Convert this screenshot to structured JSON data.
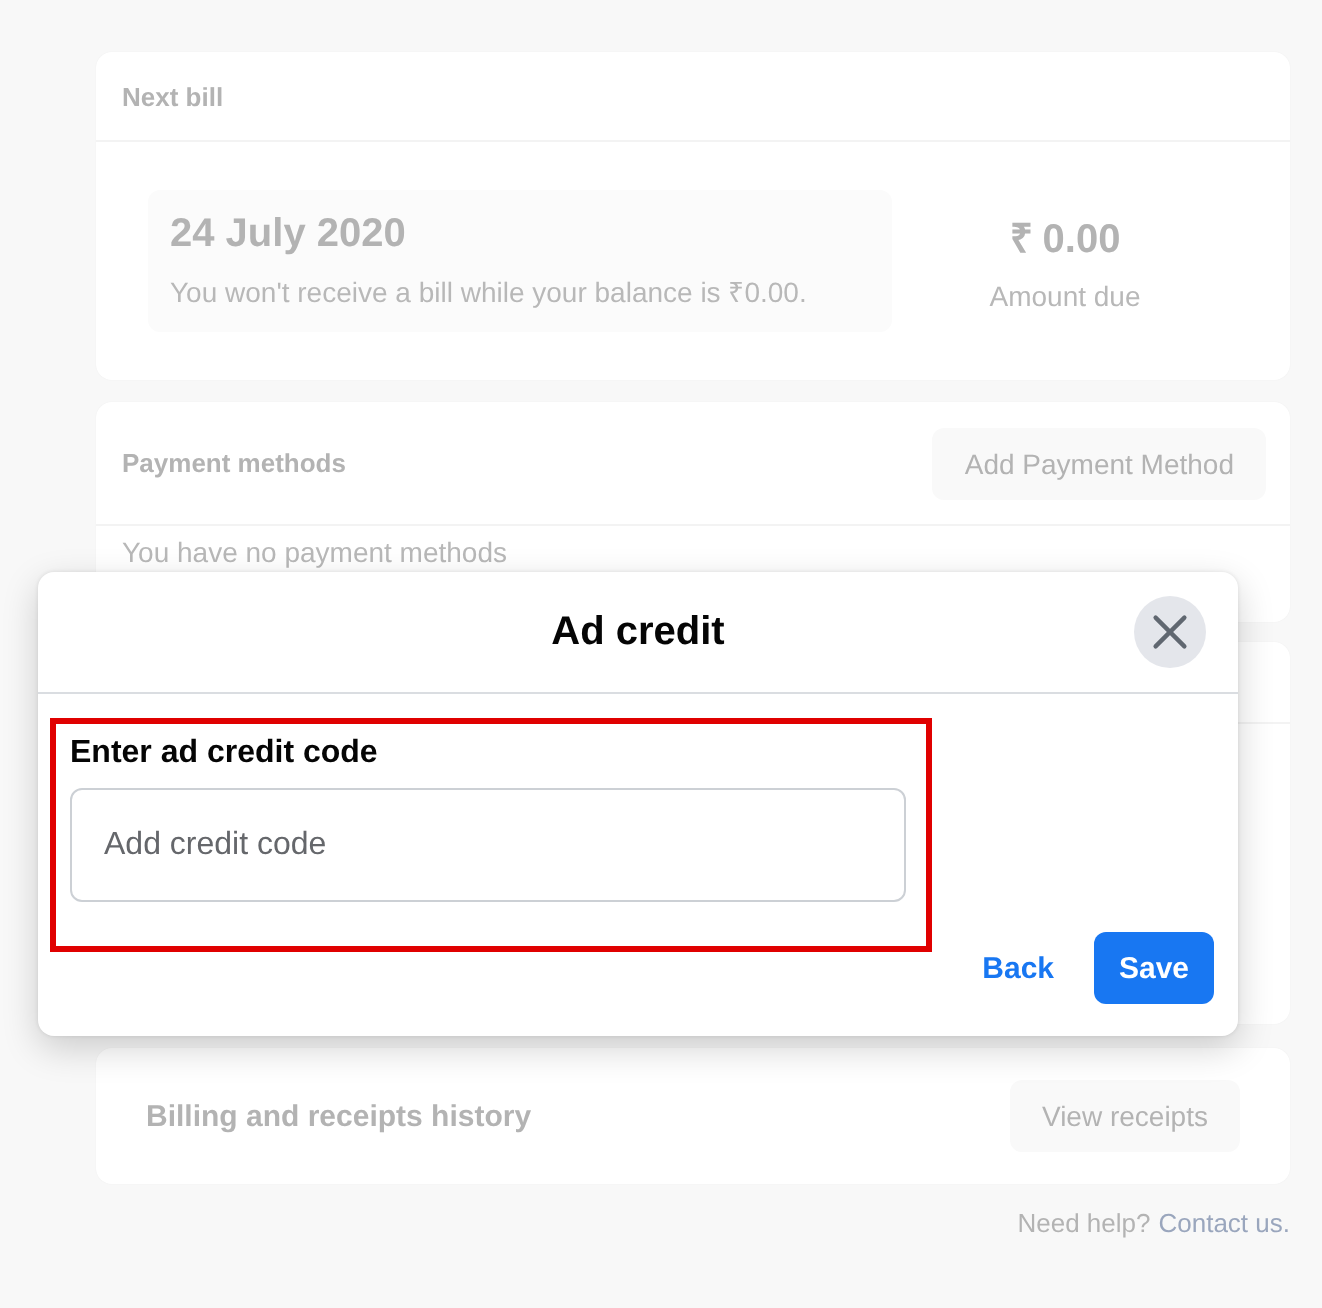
{
  "next_bill": {
    "title": "Next bill",
    "date": "24 July 2020",
    "note": "You won't receive a bill while your balance is ₹0.00.",
    "amount": "₹ 0.00",
    "amount_label": "Amount due"
  },
  "payment_methods": {
    "title": "Payment methods",
    "button": "Add Payment Method",
    "empty_text": "You have no payment methods"
  },
  "billing_history": {
    "title": "Billing and receipts history",
    "button": "View receipts"
  },
  "help": {
    "text": "Need help?",
    "link": "Contact us."
  },
  "dialog": {
    "title": "Ad credit",
    "code_field": {
      "label": "Enter ad credit code",
      "placeholder": "Add credit code",
      "highlighted": true
    },
    "buttons": [
      {
        "label": "Back",
        "kind": "link"
      },
      {
        "label": "Save",
        "kind": "primary"
      }
    ]
  }
}
